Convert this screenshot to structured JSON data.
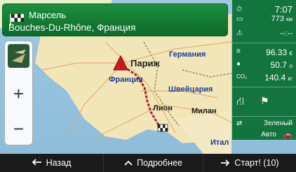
{
  "destination": {
    "line1": "Марсель",
    "line2": "Bouches-Du-Rhône, Франция"
  },
  "map_labels": {
    "paris": "Париж",
    "france": "Франция",
    "germany": "Германия",
    "switzerland": "Швейцария",
    "lyon": "Лион",
    "milan": "Милан",
    "italy": "Итал"
  },
  "right_panel": {
    "arrival_time": "7:07",
    "distance": "773",
    "distance_unit": "км",
    "time_remaining": "--:--",
    "cost": "96.33",
    "cost_unit": "€",
    "fuel": "50.7",
    "fuel_unit": "л",
    "co2": "140.4",
    "co2_unit": "кг",
    "co2_label": "CO₂",
    "route_green": "Зеленый",
    "vehicle": "Авто"
  },
  "bottom_bar": {
    "back": "Назад",
    "more": "Подробнее",
    "start": "Старт! (10)"
  },
  "colors": {
    "accent_green": "#0d6b2a",
    "route_line": "#a52a2a",
    "bar_bg": "#1a1a1a"
  }
}
